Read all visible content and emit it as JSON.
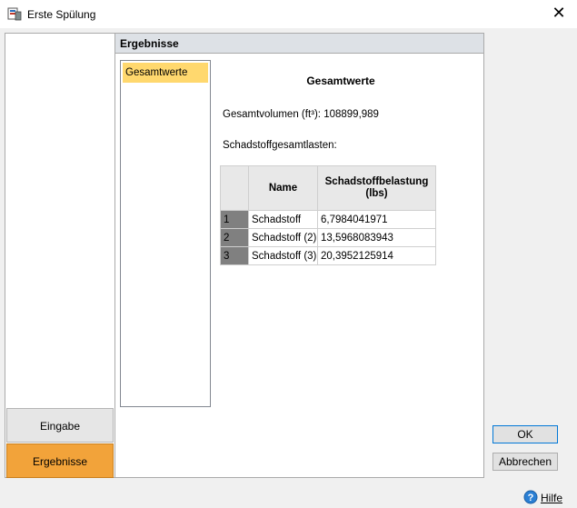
{
  "window": {
    "title": "Erste Spülung",
    "close_glyph": "✕"
  },
  "section_header": "Ergebnisse",
  "nav": {
    "input_label": "Eingabe",
    "results_label": "Ergebnisse"
  },
  "list": {
    "items": [
      "Gesamtwerte"
    ]
  },
  "content": {
    "title": "Gesamtwerte",
    "volume_line": "Gesamtvolumen (ft³): 108899,989",
    "loads_label": "Schadstoffgesamtlasten:"
  },
  "table": {
    "columns": [
      "Name",
      "Schadstoffbelastung (lbs)"
    ],
    "rows": [
      {
        "index": "1",
        "name": "Schadstoff",
        "value": "6,7984041971"
      },
      {
        "index": "2",
        "name": "Schadstoff (2)",
        "value": "13,5968083943"
      },
      {
        "index": "3",
        "name": "Schadstoff (3)",
        "value": "20,3952125914"
      }
    ]
  },
  "buttons": {
    "ok": "OK",
    "cancel": "Abbrechen"
  },
  "help": {
    "label": "Hilfe",
    "icon": "help-icon"
  },
  "colors": {
    "accent_orange": "#f2a33a",
    "selection_yellow": "#ffd86e",
    "header_gray": "#dde1e6"
  }
}
